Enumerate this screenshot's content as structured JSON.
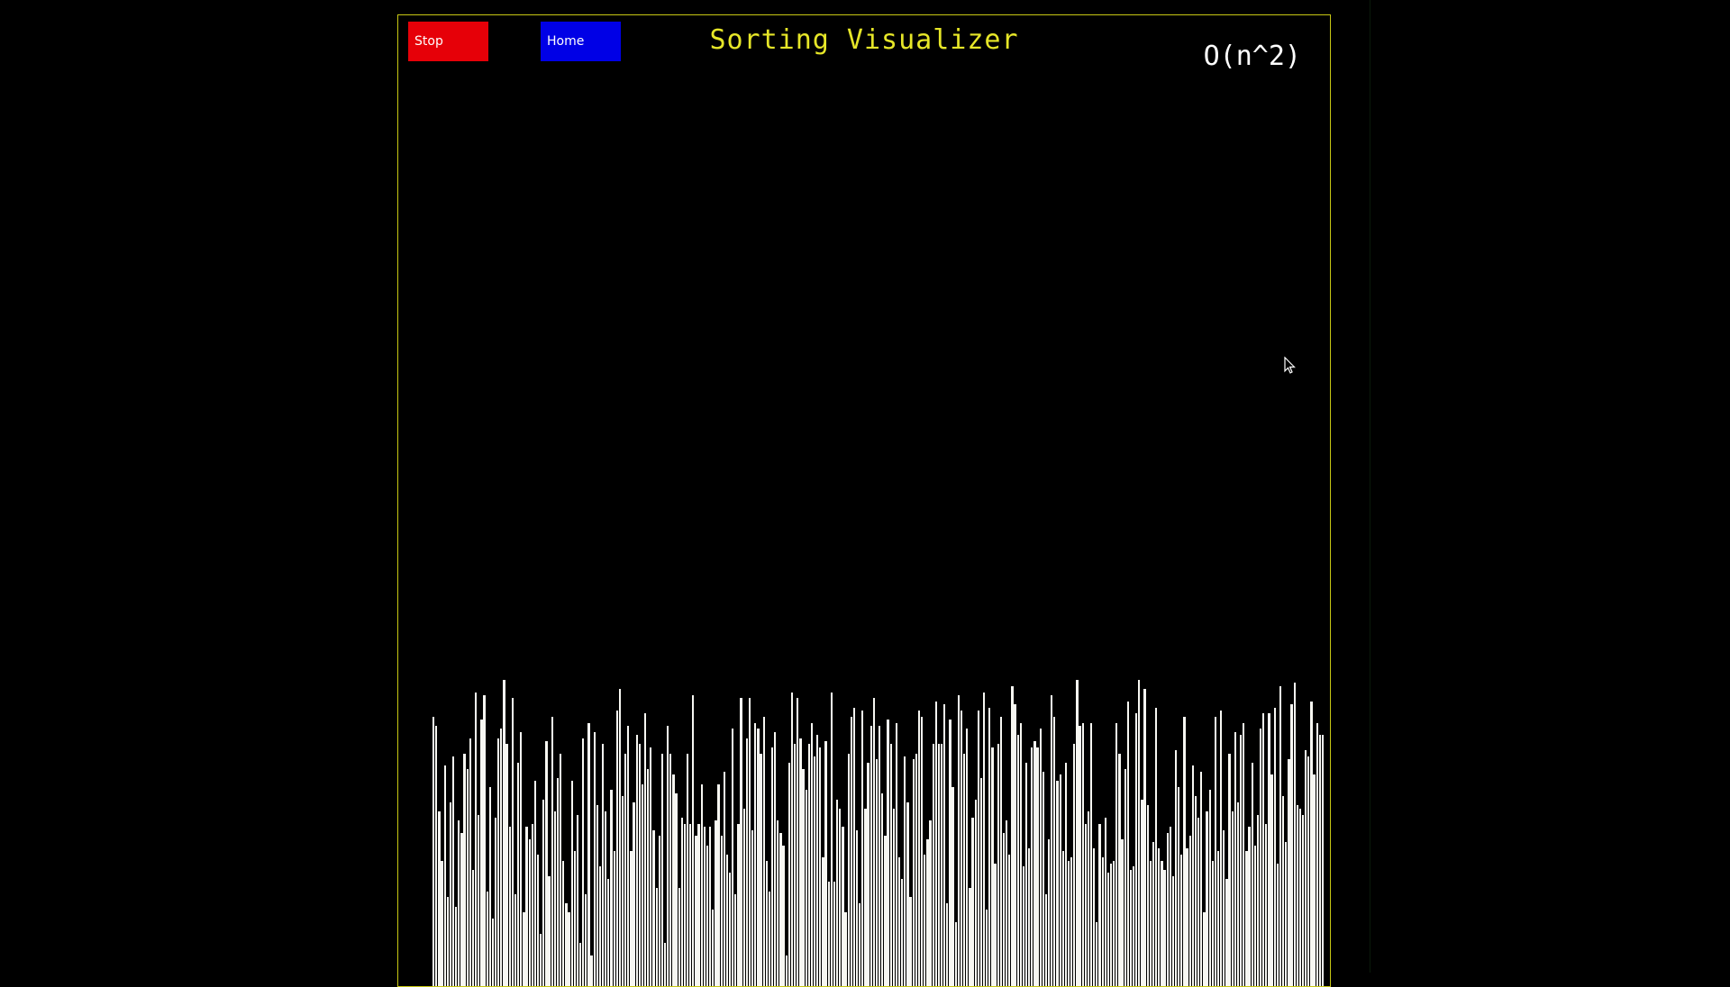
{
  "controls": {
    "stop_label": "Stop",
    "home_label": "Home"
  },
  "header": {
    "title": "Sorting Visualizer",
    "complexity": "O(n^2)"
  },
  "colors": {
    "stop": "#e60008",
    "home": "#0000e6",
    "title": "#e6e628",
    "frame": "#c8c814",
    "bar": "#f7f7f2"
  },
  "icons": {
    "cursor": "mouse-cursor-icon"
  },
  "array_state": {
    "max_value": 100,
    "values": [
      88,
      85,
      57,
      41,
      72,
      29,
      60,
      75,
      26,
      54,
      50,
      76,
      71,
      81,
      38,
      96,
      56,
      87,
      95,
      31,
      65,
      22,
      55,
      81,
      84,
      100,
      79,
      52,
      94,
      30,
      73,
      83,
      24,
      52,
      48,
      53,
      67,
      43,
      17,
      61,
      80,
      36,
      88,
      57,
      68,
      76,
      41,
      27,
      24,
      67,
      44,
      56,
      14,
      81,
      30,
      86,
      10,
      83,
      59,
      39,
      79,
      57,
      35,
      64,
      44,
      90,
      97,
      62,
      76,
      85,
      44,
      60,
      82,
      79,
      66,
      89,
      71,
      78,
      51,
      32,
      49,
      76,
      14,
      85,
      76,
      69,
      63,
      32,
      55,
      53,
      76,
      53,
      95,
      49,
      53,
      66,
      52,
      46,
      52,
      25,
      54,
      66,
      49,
      70,
      43,
      37,
      84,
      30,
      53,
      94,
      58,
      81,
      94,
      51,
      86,
      84,
      76,
      88,
      41,
      31,
      78,
      83,
      54,
      50,
      46,
      10,
      73,
      96,
      79,
      94,
      81,
      71,
      64,
      79,
      86,
      75,
      82,
      78,
      42,
      80,
      34,
      96,
      34,
      61,
      58,
      52,
      24,
      76,
      88,
      91,
      51,
      27,
      90,
      58,
      73,
      85,
      94,
      74,
      85,
      63,
      49,
      87,
      79,
      58,
      86,
      42,
      35,
      75,
      60,
      29,
      74,
      76,
      90,
      88,
      43,
      48,
      54,
      79,
      93,
      79,
      79,
      92,
      27,
      87,
      65,
      21,
      95,
      90,
      76,
      84,
      32,
      55,
      61,
      90,
      68,
      96,
      25,
      91,
      78,
      40,
      79,
      88,
      50,
      54,
      43,
      98,
      92,
      82,
      86,
      39,
      73,
      45,
      78,
      80,
      78,
      84,
      70,
      30,
      48,
      95,
      88,
      67,
      69,
      44,
      73,
      41,
      42,
      79,
      100,
      85,
      86,
      53,
      57,
      86,
      45,
      21,
      53,
      42,
      55,
      37,
      40,
      41,
      86,
      76,
      48,
      71,
      93,
      38,
      39,
      89,
      100,
      61,
      97,
      59,
      41,
      47,
      91,
      45,
      41,
      38,
      50,
      52,
      36,
      77,
      65,
      43,
      88,
      45,
      49,
      72,
      62,
      55,
      70,
      24,
      57,
      64,
      41,
      88,
      44,
      90,
      51,
      35,
      76,
      57,
      83,
      60,
      82,
      86,
      44,
      52,
      73,
      46,
      56,
      84,
      89,
      53,
      89,
      69,
      91,
      40,
      98,
      62,
      47,
      74,
      92,
      99,
      59,
      58,
      56,
      77,
      75,
      93,
      69,
      86,
      82,
      82
    ]
  }
}
